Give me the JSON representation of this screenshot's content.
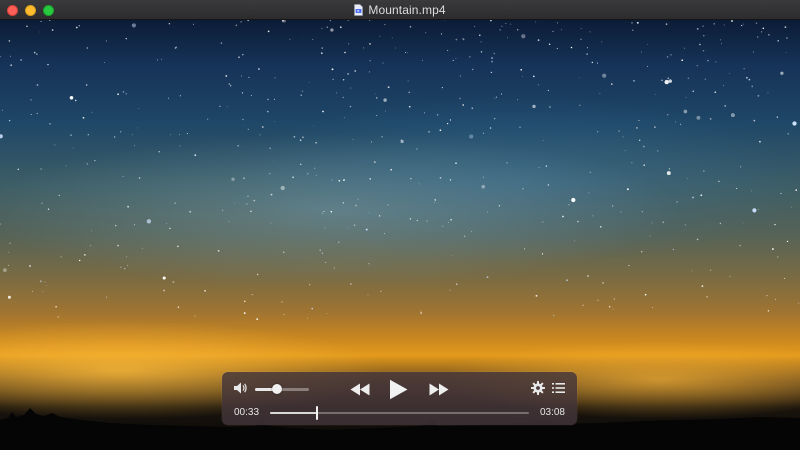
{
  "window": {
    "title": "Mountain.mp4",
    "file_icon": "video-file-icon"
  },
  "player": {
    "volume_icon": "speaker-icon",
    "volume_level": 0.4,
    "transport": {
      "rewind_icon": "rewind-icon",
      "play_icon": "play-icon",
      "fast_forward_icon": "fast-forward-icon"
    },
    "settings_icon": "gear-icon",
    "playlist_icon": "list-icon",
    "elapsed_time": "00:33",
    "total_time": "03:08",
    "progress": 0.18
  },
  "colors": {
    "close": "#fe5f57",
    "minimize": "#febc2e",
    "maximize": "#28c840",
    "file_icon_accent": "#4a6cf7"
  }
}
